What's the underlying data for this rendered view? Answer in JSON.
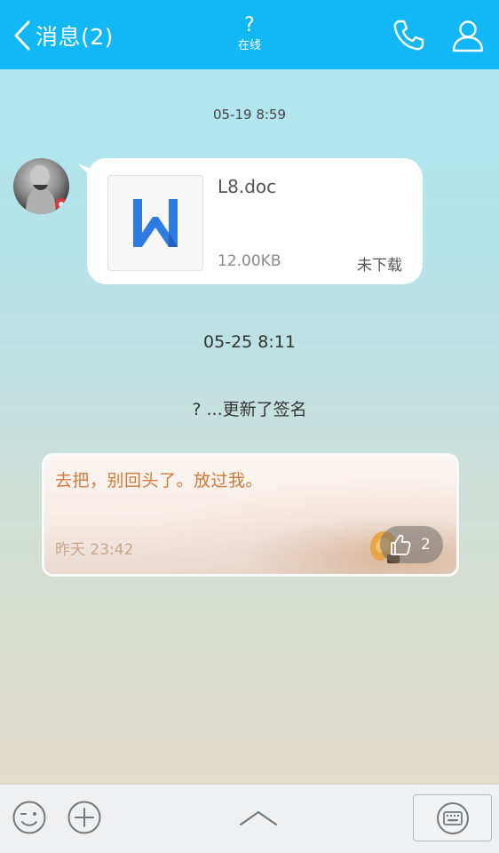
{
  "header": {
    "back_label": "消息(2)",
    "contact_name": "?",
    "status": "在线",
    "phone_icon": "phone-icon",
    "profile_icon": "user-profile-icon",
    "bg_color": "#12b7f5"
  },
  "messages": [
    {
      "timestamp": "05-19 8:59"
    },
    {
      "file_name": "L8.doc",
      "file_size": "12.00KB",
      "file_status": "未下载",
      "file_icon": "word-doc-icon"
    },
    {
      "timestamp": "05-25 8:11"
    },
    {
      "system_text": "? ...更新了签名"
    }
  ],
  "signature_card": {
    "text": "去把，别回头了。放过我。",
    "time": "昨天 23:42",
    "like_count": "2"
  },
  "bottom_bar": {
    "emoji_icon": "emoji-icon",
    "plus_icon": "plus-icon",
    "expand_icon": "chevron-up-icon",
    "keyboard_icon": "keyboard-icon"
  }
}
